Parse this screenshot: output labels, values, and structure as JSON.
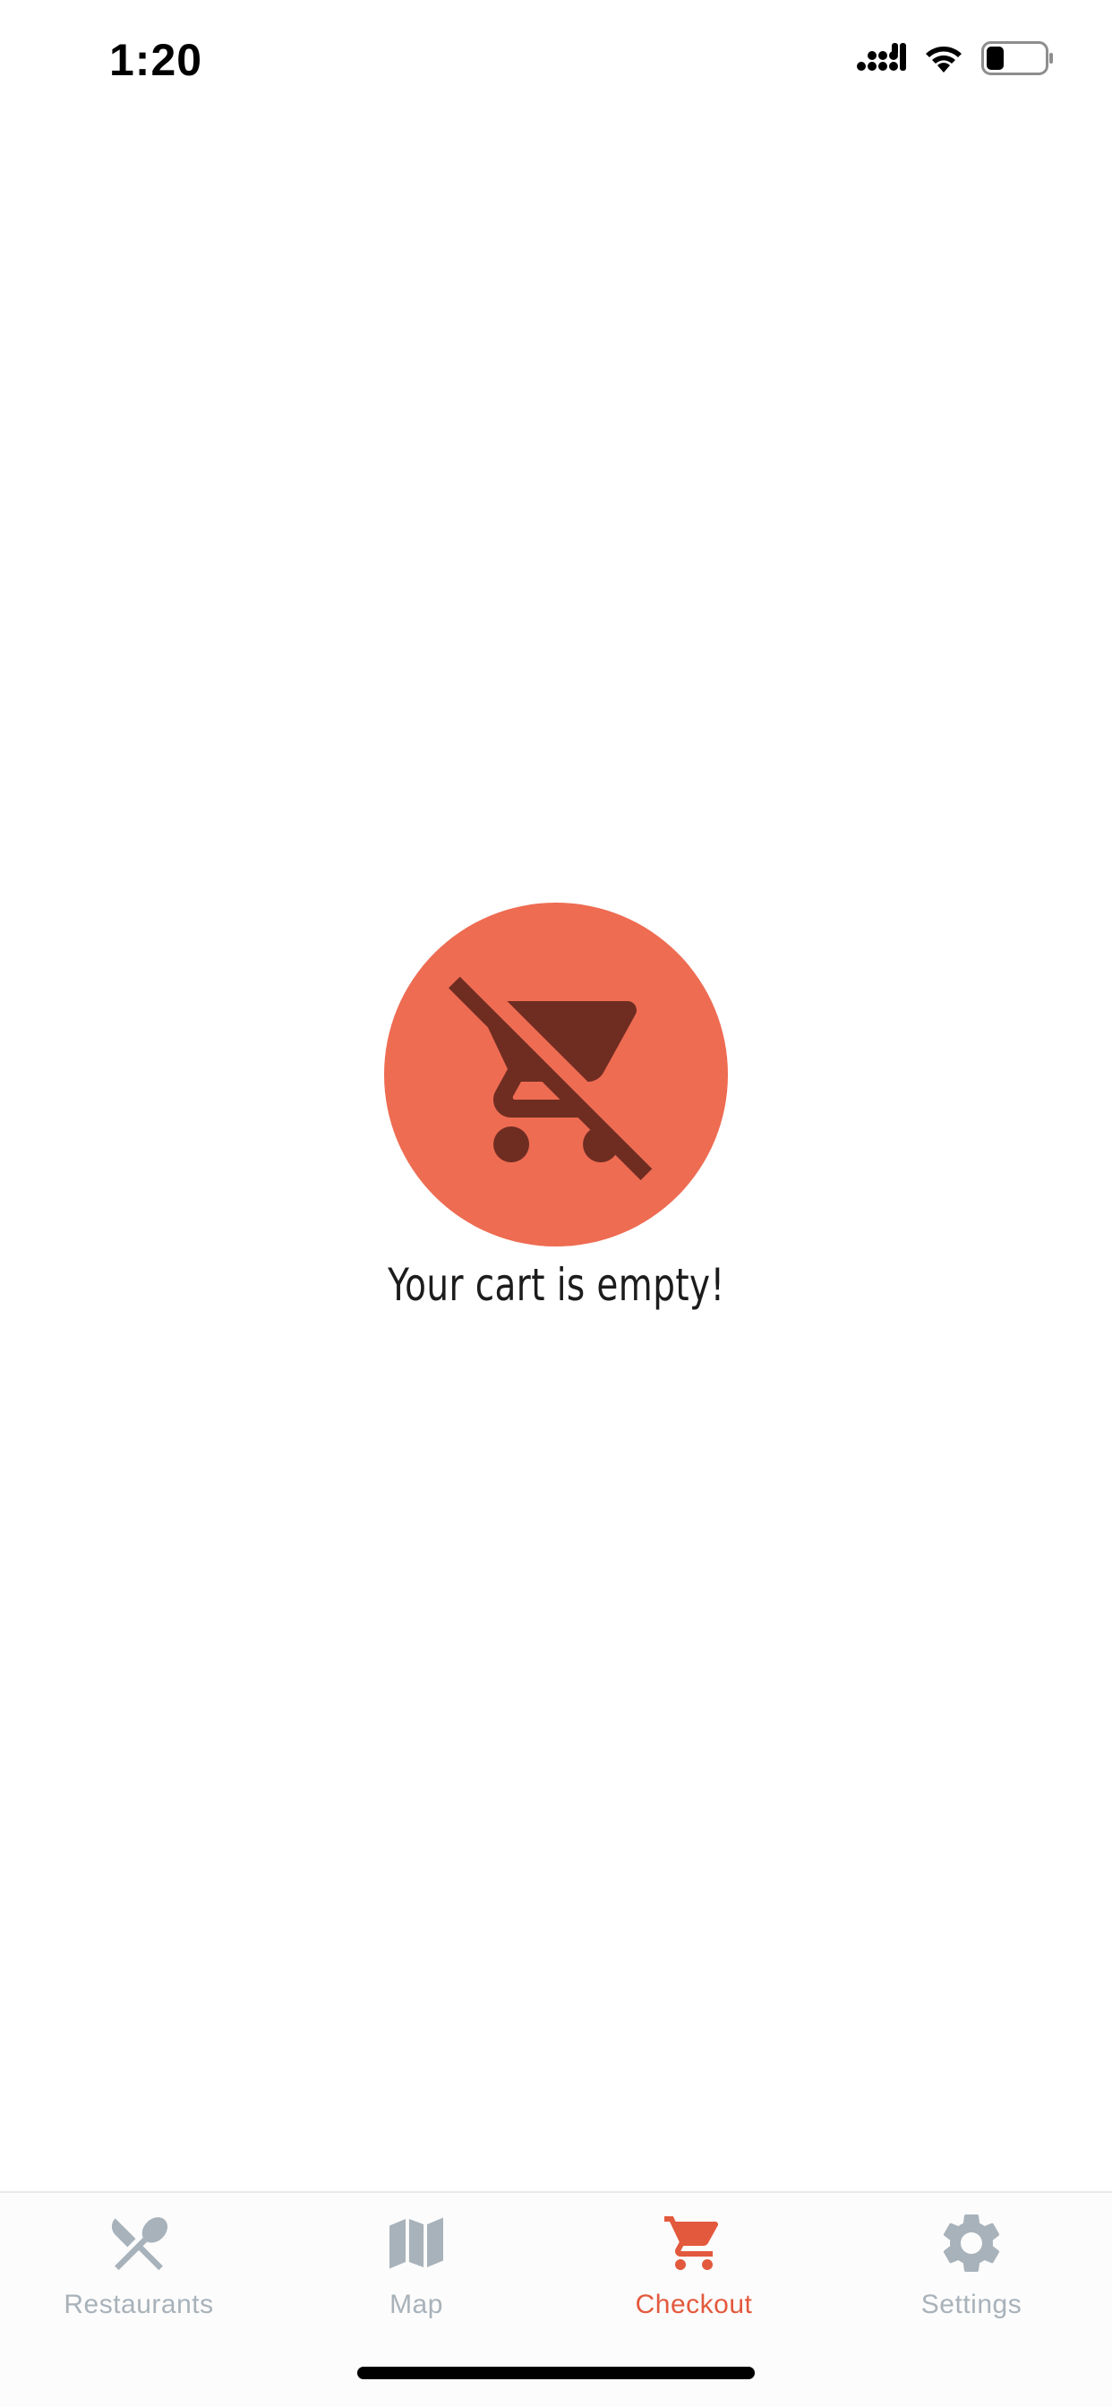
{
  "status_bar": {
    "time": "1:20",
    "icons": [
      "signal-icon",
      "wifi-icon",
      "battery-icon"
    ],
    "battery_level": 0.3
  },
  "empty_state": {
    "icon": "remove-shopping-cart-icon",
    "message": "Your cart is empty!",
    "circle_color": "#ee6c52",
    "icon_color": "#6f2d22"
  },
  "tab_bar": {
    "active_color": "#e3593d",
    "inactive_color": "#a8b2ba",
    "tabs": [
      {
        "label": "Restaurants",
        "icon": "fork-knife-icon",
        "active": false
      },
      {
        "label": "Map",
        "icon": "map-icon",
        "active": false
      },
      {
        "label": "Checkout",
        "icon": "cart-icon",
        "active": true
      },
      {
        "label": "Settings",
        "icon": "gear-icon",
        "active": false
      }
    ]
  }
}
